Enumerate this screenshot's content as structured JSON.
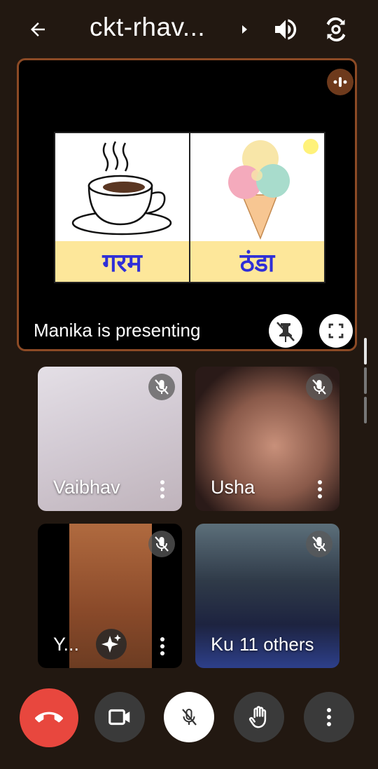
{
  "header": {
    "title": "ckt-rhav...",
    "icons": [
      "back-arrow-icon",
      "chevron-right-icon",
      "speaker-icon",
      "switch-camera-icon"
    ]
  },
  "presentation": {
    "status_label": "Manika is presenting",
    "slide": {
      "left_word": "गरम",
      "right_word": "ठंडा"
    },
    "icons": [
      "audio-indicator-icon",
      "unpin-icon",
      "fullscreen-icon"
    ]
  },
  "participants": [
    {
      "name": "Vaibhav",
      "muted": true
    },
    {
      "name": "Usha",
      "muted": true
    },
    {
      "name": "Y...",
      "muted": true
    },
    {
      "name": "Ku",
      "muted": true,
      "overlay_label": "11 others"
    }
  ],
  "controls": {
    "icons": [
      "end-call-icon",
      "camera-icon",
      "mic-off-icon",
      "raise-hand-icon",
      "more-options-icon"
    ]
  },
  "colors": {
    "background": "#221811",
    "presentation_border": "#8c4a25",
    "end_call": "#e8473e",
    "slide_word_bg": "#fde79a",
    "slide_word_text": "#2f2fd8"
  }
}
